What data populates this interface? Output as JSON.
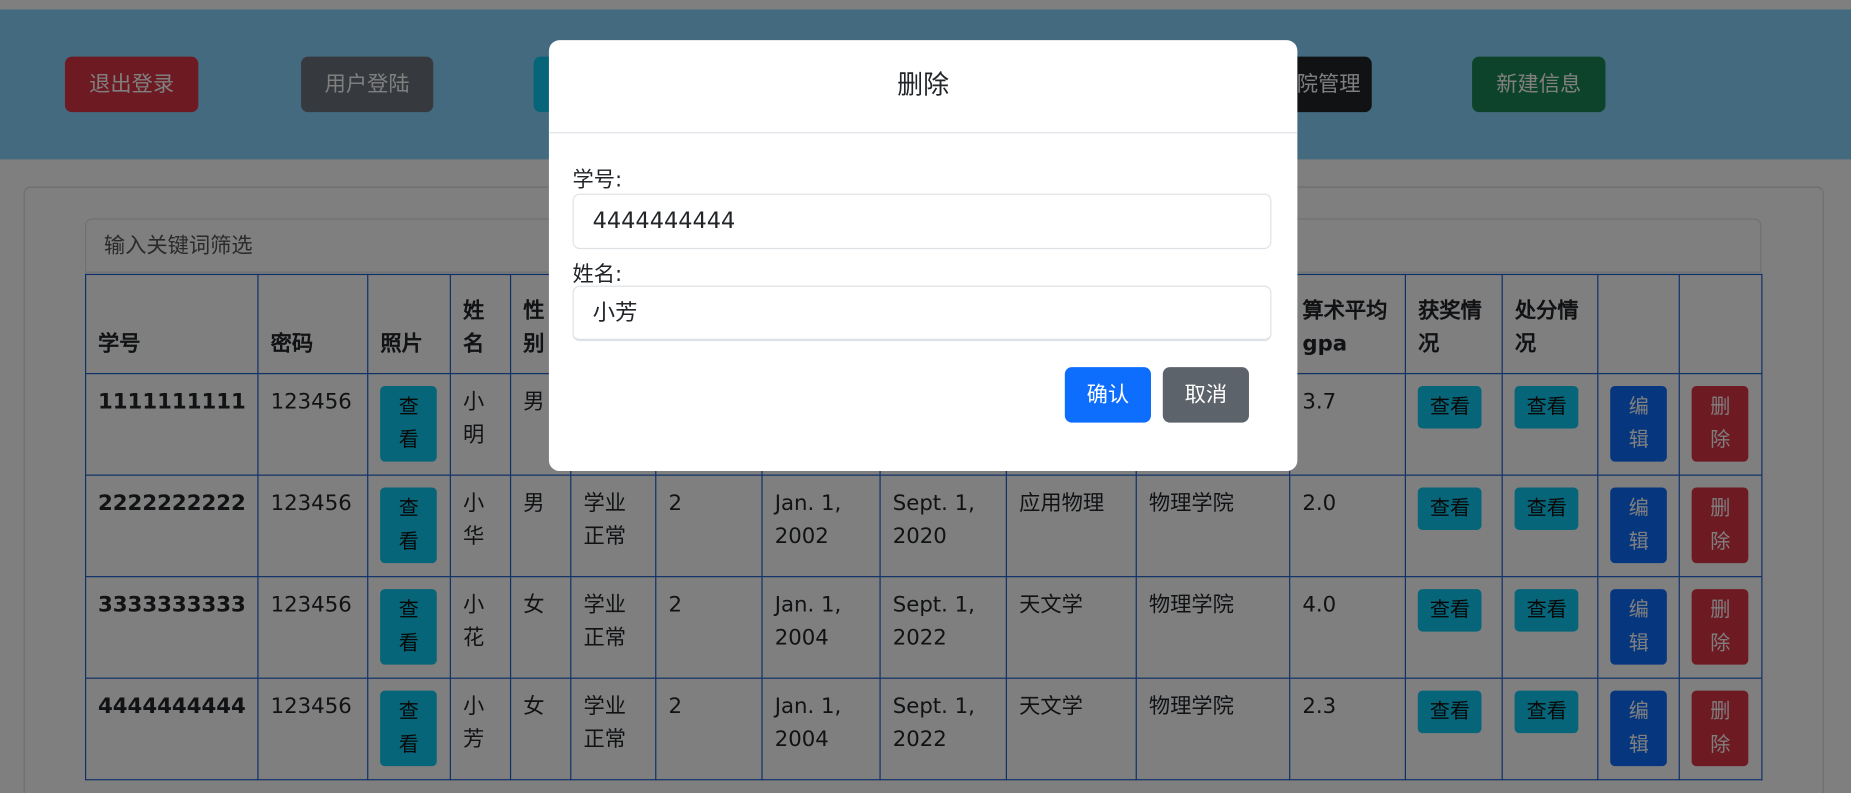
{
  "navbar": {
    "buttons": [
      {
        "label": "退出登录",
        "color": "#dc3545"
      },
      {
        "label": "用户登陆",
        "color": "#6c757d"
      },
      {
        "label": "",
        "color": "#0dcaf0"
      },
      {
        "label": "院管理",
        "color": "#212529"
      },
      {
        "label": "新建信息",
        "color": "#198754"
      }
    ]
  },
  "filter": {
    "placeholder": "输入关键词筛选"
  },
  "table": {
    "headers": [
      "学号",
      "密码",
      "照片",
      "姓名",
      "性别",
      "",
      "",
      "",
      "",
      "",
      "",
      "算术平均gpa",
      "获奖情况",
      "处分情况",
      "",
      ""
    ],
    "view_label": "查看",
    "edit_label": "编辑",
    "delete_label": "删除",
    "rows": [
      [
        "1111111111",
        "123456",
        "小明",
        "男",
        "",
        "",
        "",
        "",
        "",
        "",
        "3.7"
      ],
      [
        "2222222222",
        "123456",
        "小华",
        "男",
        "学业正常",
        "2",
        "Jan. 1, 2002",
        "Sept. 1, 2020",
        "应用物理",
        "物理学院",
        "2.0"
      ],
      [
        "3333333333",
        "123456",
        "小花",
        "女",
        "学业正常",
        "2",
        "Jan. 1, 2004",
        "Sept. 1, 2022",
        "天文学",
        "物理学院",
        "4.0"
      ],
      [
        "4444444444",
        "123456",
        "小芳",
        "女",
        "学业正常",
        "2",
        "Jan. 1, 2004",
        "Sept. 1, 2022",
        "天文学",
        "物理学院",
        "2.3"
      ]
    ]
  },
  "modal": {
    "title": "删除",
    "id_label": "学号:",
    "id_value": "4444444444",
    "name_label": "姓名:",
    "name_value": "小芳",
    "confirm": "确认",
    "cancel": "取消"
  }
}
